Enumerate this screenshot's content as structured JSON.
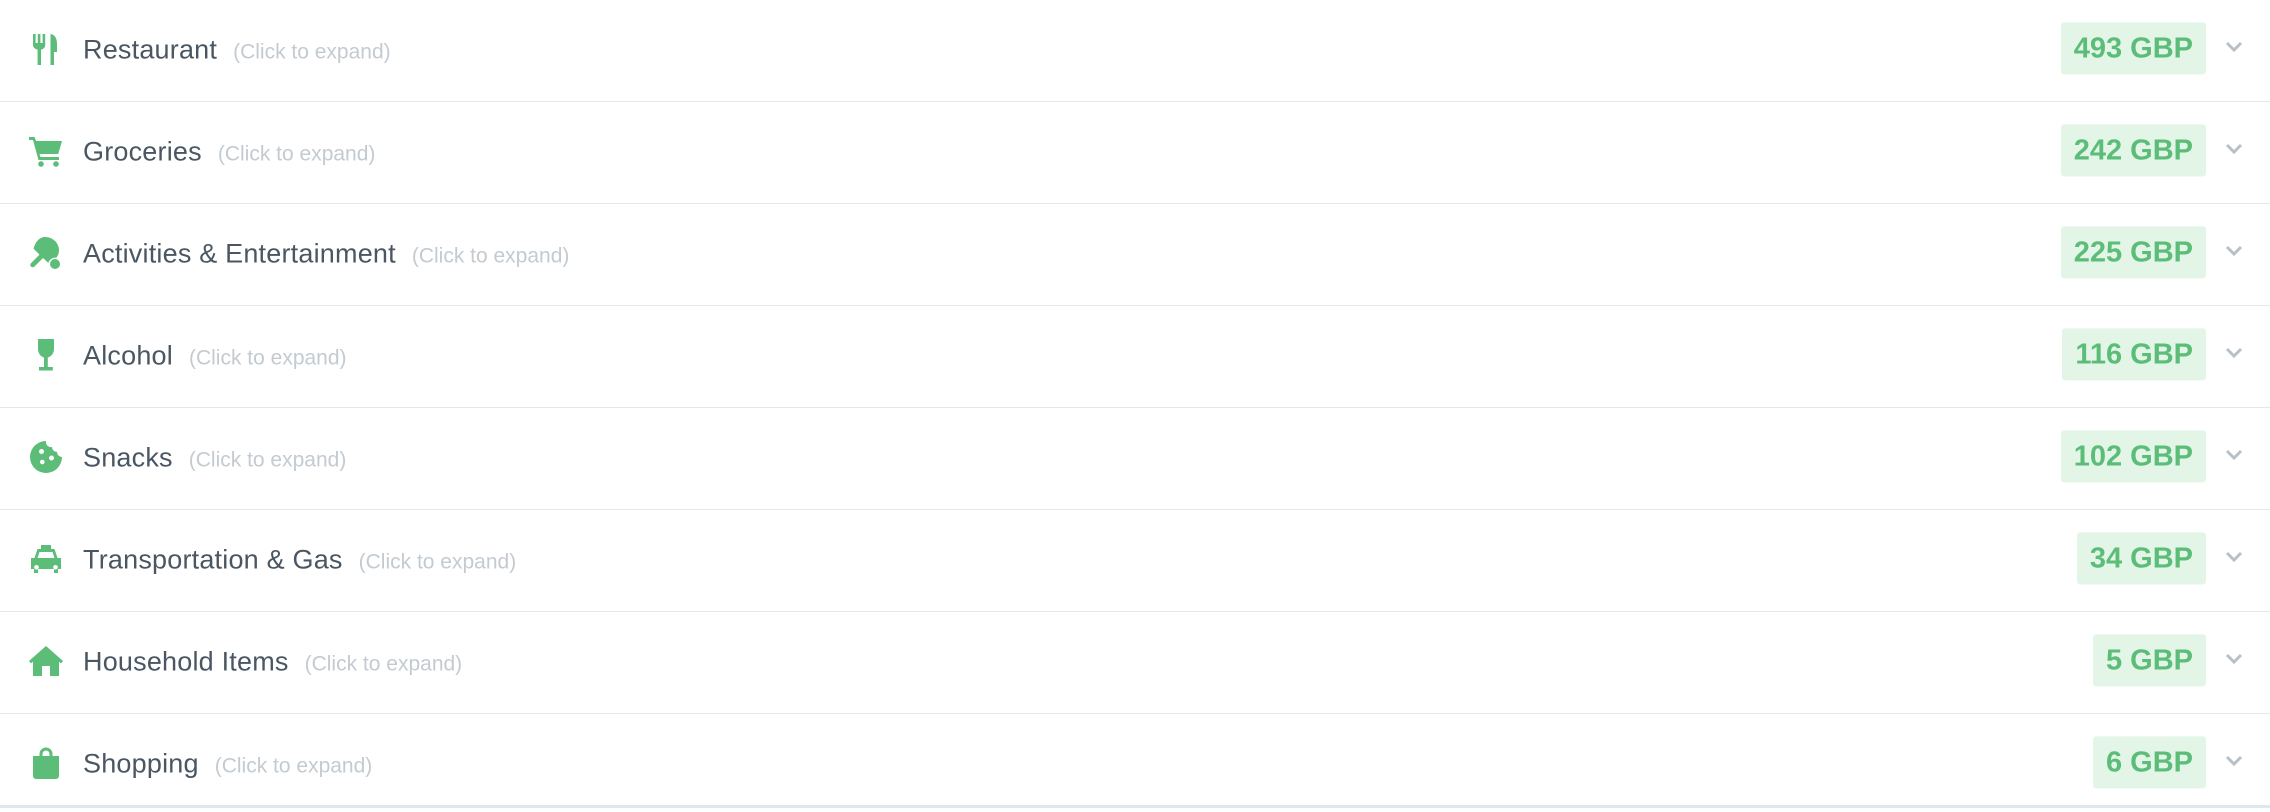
{
  "categories": [
    {
      "name": "Restaurant",
      "hint": "(Click to expand)",
      "amount": "493 GBP",
      "icon": "utensils-icon"
    },
    {
      "name": "Groceries",
      "hint": "(Click to expand)",
      "amount": "242 GBP",
      "icon": "shopping-cart-icon"
    },
    {
      "name": "Activities & Entertainment",
      "hint": "(Click to expand)",
      "amount": "225 GBP",
      "icon": "table-tennis-icon"
    },
    {
      "name": "Alcohol",
      "hint": "(Click to expand)",
      "amount": "116 GBP",
      "icon": "wine-glass-icon"
    },
    {
      "name": "Snacks",
      "hint": "(Click to expand)",
      "amount": "102 GBP",
      "icon": "cookie-icon"
    },
    {
      "name": "Transportation & Gas",
      "hint": "(Click to expand)",
      "amount": "34 GBP",
      "icon": "taxi-icon"
    },
    {
      "name": "Household Items",
      "hint": "(Click to expand)",
      "amount": "5 GBP",
      "icon": "home-icon"
    },
    {
      "name": "Shopping",
      "hint": "(Click to expand)",
      "amount": "6 GBP",
      "icon": "shopping-bag-icon"
    }
  ],
  "colors": {
    "accent": "#5bbd78",
    "amount_bg": "#e2f5e7",
    "text": "#4a5763",
    "hint": "#c3cbd1"
  }
}
